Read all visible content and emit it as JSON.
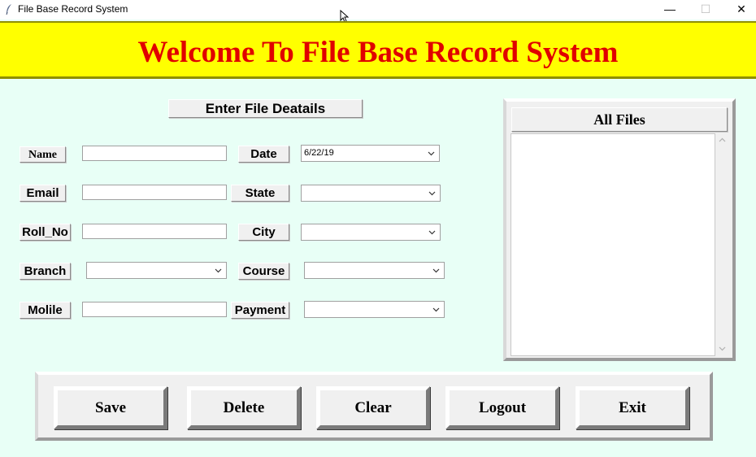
{
  "window": {
    "title": "File Base Record System",
    "minimize": "—",
    "maximize": "☐",
    "close": "✕"
  },
  "banner": {
    "title": "Welcome To File Base Record System",
    "bg_color": "#ffff00",
    "text_color": "#e00000"
  },
  "form": {
    "heading": "Enter File Deatails",
    "name_label": "Name",
    "email_label": "Email",
    "rollno_label": "Roll_No",
    "branch_label": "Branch",
    "mobile_label": "Molile",
    "date_label": "Date",
    "state_label": "State",
    "city_label": "City",
    "course_label": "Course",
    "payment_label": "Payment",
    "name_value": "",
    "email_value": "",
    "rollno_value": "",
    "mobile_value": "",
    "branch_value": "",
    "date_value": "6/22/19",
    "state_value": "",
    "city_value": "",
    "course_value": "",
    "payment_value": ""
  },
  "files": {
    "heading": "All Files",
    "items": []
  },
  "buttons": {
    "save": "Save",
    "delete": "Delete",
    "clear": "Clear",
    "logout": "Logout",
    "exit": "Exit"
  },
  "icons": {
    "app": "feather-icon",
    "dropdown": "chevron-down-icon",
    "cursor": "mouse-pointer-icon"
  }
}
